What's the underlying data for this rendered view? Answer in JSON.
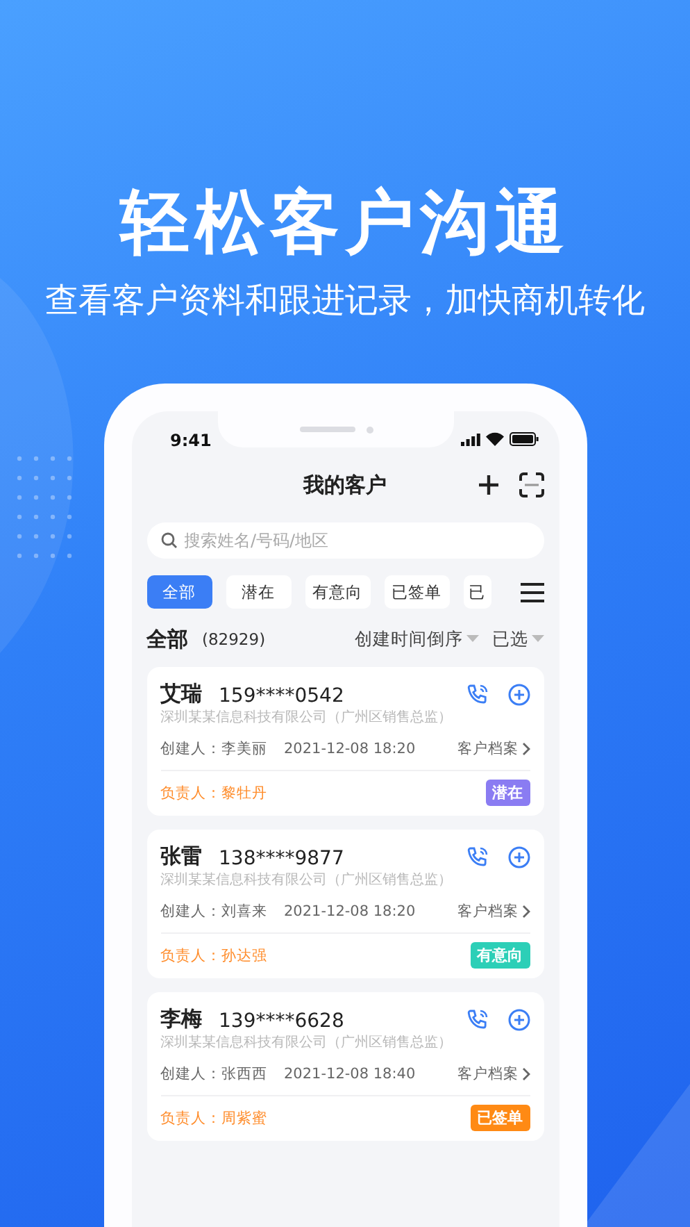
{
  "headline": "轻松客户沟通",
  "subtitle": "查看客户资料和跟进记录，加快商机转化",
  "status_bar": {
    "time": "9:41"
  },
  "header": {
    "title": "我的客户"
  },
  "search": {
    "placeholder": "搜索姓名/号码/地区"
  },
  "filters": [
    {
      "label": "全部",
      "selected": true
    },
    {
      "label": "潜在",
      "selected": false
    },
    {
      "label": "有意向",
      "selected": false
    },
    {
      "label": "已签单",
      "selected": false
    },
    {
      "label": "已",
      "selected": false
    }
  ],
  "summary": {
    "label": "全部",
    "count": "(82929)",
    "sort": "创建时间倒序",
    "selected_filter": "已选"
  },
  "customers": [
    {
      "name": "艾瑞",
      "phone": "159****0542",
      "company": "深圳某某信息科技有限公司（广州区销售总监）",
      "creator": "创建人：李美丽",
      "time": "2021-12-08 18:20",
      "profile_link": "客户档案",
      "owner": "负责人：黎牡丹",
      "status": "潜在",
      "color": "#8a7cf2"
    },
    {
      "name": "张雷",
      "phone": "138****9877",
      "company": "深圳某某信息科技有限公司（广州区销售总监）",
      "creator": "创建人：刘喜来",
      "time": "2021-12-08 18:20",
      "profile_link": "客户档案",
      "owner": "负责人：孙达强",
      "status": "有意向",
      "color": "#2ccfb7"
    },
    {
      "name": "李梅",
      "phone": "139****6628",
      "company": "深圳某某信息科技有限公司（广州区销售总监）",
      "creator": "创建人：张西西",
      "time": "2021-12-08 18:40",
      "profile_link": "客户档案",
      "owner": "负责人：周紫蜜",
      "status": "已签单",
      "color": "#ff8a14"
    }
  ]
}
